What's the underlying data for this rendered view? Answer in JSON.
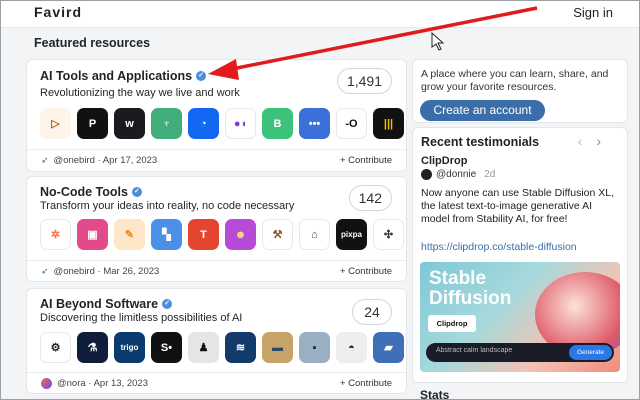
{
  "header": {
    "logo": "Favird",
    "signin": "Sign in"
  },
  "featured": {
    "title": "Featured resources"
  },
  "cards": [
    {
      "title": "AI Tools and Applications",
      "subtitle": "Revolutionizing the way we live and work",
      "count": "1,491",
      "author": "@onebird",
      "date": "Apr 17, 2023",
      "author_line": "@onebird · Apr 17, 2023",
      "contribute": "+ Contribute",
      "icons": [
        {
          "name": "play-outline-icon",
          "bg": "#fff4ea",
          "fg": "#b65d1a",
          "glyph": "▷"
        },
        {
          "name": "pika-p-icon",
          "bg": "#111111",
          "fg": "#ffffff",
          "glyph": "P"
        },
        {
          "name": "wave-icon",
          "bg": "#1b1b1f",
          "fg": "#ffffff",
          "glyph": "w"
        },
        {
          "name": "leaf-icon",
          "bg": "#3fae7a",
          "fg": "#ffffff",
          "glyph": "♆"
        },
        {
          "name": "timer-icon",
          "bg": "#1467f2",
          "fg": "#ffffff",
          "glyph": "◔"
        },
        {
          "name": "purple-bubbles-icon",
          "bg": "#ffffff",
          "fg": "#7b3fe4",
          "glyph": "●◖"
        },
        {
          "name": "letter-b-icon",
          "bg": "#3cc27a",
          "fg": "#ffffff",
          "glyph": "B"
        },
        {
          "name": "dots-icon",
          "bg": "#3b6fd9",
          "fg": "#ffffff",
          "glyph": "•••"
        },
        {
          "name": "ring-line-icon",
          "bg": "#ffffff",
          "fg": "#111111",
          "glyph": "-O"
        },
        {
          "name": "barcode-icon",
          "bg": "#111111",
          "fg": "#f2c200",
          "glyph": "|||"
        }
      ]
    },
    {
      "title": "No-Code Tools",
      "subtitle": "Transform your ideas into reality, no code necessary",
      "count": "142",
      "author": "@onebird",
      "date": "Mar 26, 2023",
      "author_line": "@onebird · Mar 26, 2023",
      "contribute": "+ Contribute",
      "icons": [
        {
          "name": "hubspot-icon",
          "bg": "#ffffff",
          "fg": "#ff6b4a",
          "glyph": "✲"
        },
        {
          "name": "square-frame-icon",
          "bg": "#e24a8b",
          "fg": "#ffffff",
          "glyph": "▣"
        },
        {
          "name": "pencil-icon",
          "bg": "#fde7c8",
          "fg": "#f08a1c",
          "glyph": "✎"
        },
        {
          "name": "color-blocks-icon",
          "bg": "#4a8fe8",
          "fg": "#ffffff",
          "glyph": "▚"
        },
        {
          "name": "letter-t-icon",
          "bg": "#e5452f",
          "fg": "#ffffff",
          "glyph": "T"
        },
        {
          "name": "mascot-icon",
          "bg": "#b84ad8",
          "fg": "#ffe07a",
          "glyph": "☻"
        },
        {
          "name": "hammer-icon",
          "bg": "#ffffff",
          "fg": "#8a5a2a",
          "glyph": "⚒"
        },
        {
          "name": "tag-icon",
          "bg": "#ffffff",
          "fg": "#444444",
          "glyph": "⌂"
        },
        {
          "name": "pixpa-icon",
          "bg": "#111111",
          "fg": "#ffffff",
          "glyph": "pixpa"
        },
        {
          "name": "knot-icon",
          "bg": "#ffffff",
          "fg": "#333333",
          "glyph": "✣"
        }
      ]
    },
    {
      "title": "AI Beyond Software",
      "subtitle": "Discovering the limitless possibilities of AI",
      "count": "24",
      "author": "@nora",
      "date": "Apr 13, 2023",
      "author_line": "@nora · Apr 13, 2023",
      "contribute": "+ Contribute",
      "icons": [
        {
          "name": "robot-arm-icon",
          "bg": "#ffffff",
          "fg": "#222222",
          "glyph": "⚙"
        },
        {
          "name": "lab-flask-icon",
          "bg": "#0f1e3a",
          "fg": "#ffffff",
          "glyph": "⚗"
        },
        {
          "name": "trigo-icon",
          "bg": "#0b3a6e",
          "fg": "#ffffff",
          "glyph": "trigo"
        },
        {
          "name": "serve-icon",
          "bg": "#111111",
          "fg": "#ffffff",
          "glyph": "S•"
        },
        {
          "name": "penguin-robot-icon",
          "bg": "#e5e5e5",
          "fg": "#111111",
          "glyph": "♟"
        },
        {
          "name": "ocean-wave-icon",
          "bg": "#123a6a",
          "fg": "#ffffff",
          "glyph": "≋"
        },
        {
          "name": "truck-field-icon",
          "bg": "#c7a36a",
          "fg": "#2a4a6a",
          "glyph": "▬"
        },
        {
          "name": "camera-robot-icon",
          "bg": "#9ab0c2",
          "fg": "#222222",
          "glyph": "▪"
        },
        {
          "name": "dome-camera-icon",
          "bg": "#eeeeee",
          "fg": "#222222",
          "glyph": "◓"
        },
        {
          "name": "truck-icon",
          "bg": "#3f6fb8",
          "fg": "#ffffff",
          "glyph": "▰"
        }
      ]
    }
  ],
  "intro": {
    "text": "A place where you can learn, share, and grow your favorite resources.",
    "cta": "Create an account"
  },
  "testimonials": {
    "title": "Recent testimonials",
    "prev": "‹",
    "next": "›",
    "name": "ClipDrop",
    "user": "@donnie",
    "time": "2d",
    "quote": "Now anyone can use Stable Diffusion XL, the latest text-to-image generative AI model from Stability AI, for free!",
    "link": "https://clipdrop.co/stable-diffusion",
    "promo": {
      "line1": "Stable",
      "line2": "Diffusion",
      "brand": "Clipdrop",
      "input": "Abstract calm landscape",
      "button": "Generate"
    }
  },
  "stats": {
    "title": "Stats"
  },
  "colors": {
    "accent": "#3b6ea8",
    "annotation_arrow": "#e11b1b"
  }
}
